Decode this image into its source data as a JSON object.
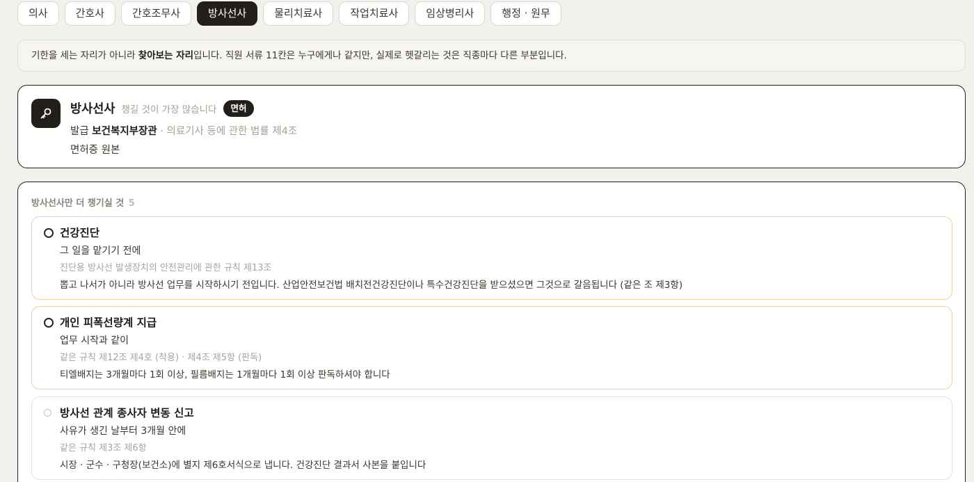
{
  "tabs": [
    {
      "label": "의사"
    },
    {
      "label": "간호사"
    },
    {
      "label": "간호조무사"
    },
    {
      "label": "방사선사",
      "active": true
    },
    {
      "label": "물리치료사"
    },
    {
      "label": "작업치료사"
    },
    {
      "label": "임상병리사"
    },
    {
      "label": "행정 · 원무"
    }
  ],
  "note": {
    "prefix": "기한을 세는 자리가 아니라 ",
    "bold": "찾아보는 자리",
    "suffix": "입니다. 직원 서류 11칸은 누구에게나 같지만, 실제로 헷갈리는 것은 직종마다 다른 부분입니다."
  },
  "profile": {
    "icon": "key-icon",
    "title": "방사선사",
    "subtitle": "챙길 것이 가장 많습니다",
    "badge": "면허",
    "issuer_label": "발급",
    "issuer": "보건복지부장관",
    "issuer_law": " · 의료기사 등에 관한 법률 제4조",
    "document": "면허증 원본"
  },
  "checklist": {
    "title": "방사선사만 더 챙기실 것",
    "count": "5",
    "items": [
      {
        "title": "건강진단",
        "when": "그 일을 맡기기 전에",
        "law": "진단용 방사선 발생장치의 안전관리에 관한 규칙 제13조",
        "desc": "뽑고 나서가 아니라 방사선 업무를 시작하시기 전입니다. 산업안전보건법 배치전건강진단이나 특수건강진단을 받으셨으면 그것으로 갈음됩니다 (같은 조 제3항)"
      },
      {
        "title": "개인 피폭선량계 지급",
        "when": "업무 시작과 같이",
        "law": "같은 규칙 제12조 제4호 (착용) · 제4조 제5항 (판독)",
        "desc": "티엘배지는 3개월마다 1회 이상, 필름배지는 1개월마다 1회 이상 판독하셔야 합니다"
      },
      {
        "title": "방사선 관계 종사자 변동 신고",
        "when": "사유가 생긴 날부터 3개월 안에",
        "law": "같은 규칙 제3조 제6항",
        "desc": "시장 · 군수 · 구청장(보건소)에 별지 제6호서식으로 냅니다. 건강진단 결과서 사본을 붙입니다"
      }
    ]
  },
  "colors": {
    "accent_dark": "#221e19",
    "highlight_border": "#e6d49e",
    "muted_text": "#a7a095",
    "background": "#f2f1ee"
  }
}
